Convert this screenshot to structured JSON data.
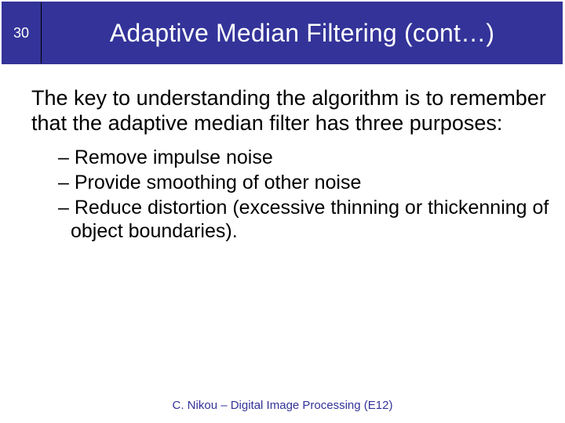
{
  "header": {
    "page_number": "30",
    "title": "Adaptive Median Filtering (cont…)"
  },
  "content": {
    "intro": "The key to understanding the algorithm is to remember that the adaptive median filter has three purposes:",
    "dash": "– ",
    "bullets": [
      "Remove impulse noise",
      "Provide smoothing of other noise",
      "Reduce distortion (excessive thinning or thickenning of object boundaries)."
    ]
  },
  "footer": {
    "text": "C. Nikou – Digital Image Processing (E12)"
  }
}
